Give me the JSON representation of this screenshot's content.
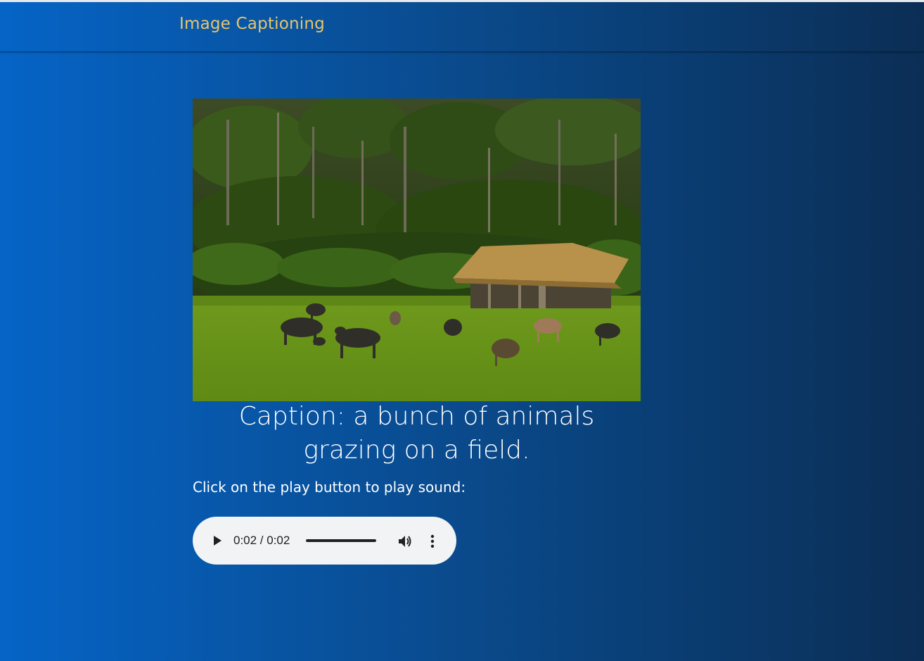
{
  "app": {
    "title": "Image Captioning"
  },
  "caption": {
    "text": "Caption: a bunch of animals grazing on a field."
  },
  "audio": {
    "hint": "Click on the play button to play sound:",
    "time": "0:02 / 0:02",
    "progress": 1.0,
    "icons": [
      "play-icon",
      "volume-icon",
      "more-options-icon"
    ]
  },
  "colors": {
    "brand_text": "#e8c46a",
    "background_left": "#0564c6",
    "background_right": "#0b2e55",
    "player_bg": "#f1f3f4"
  }
}
